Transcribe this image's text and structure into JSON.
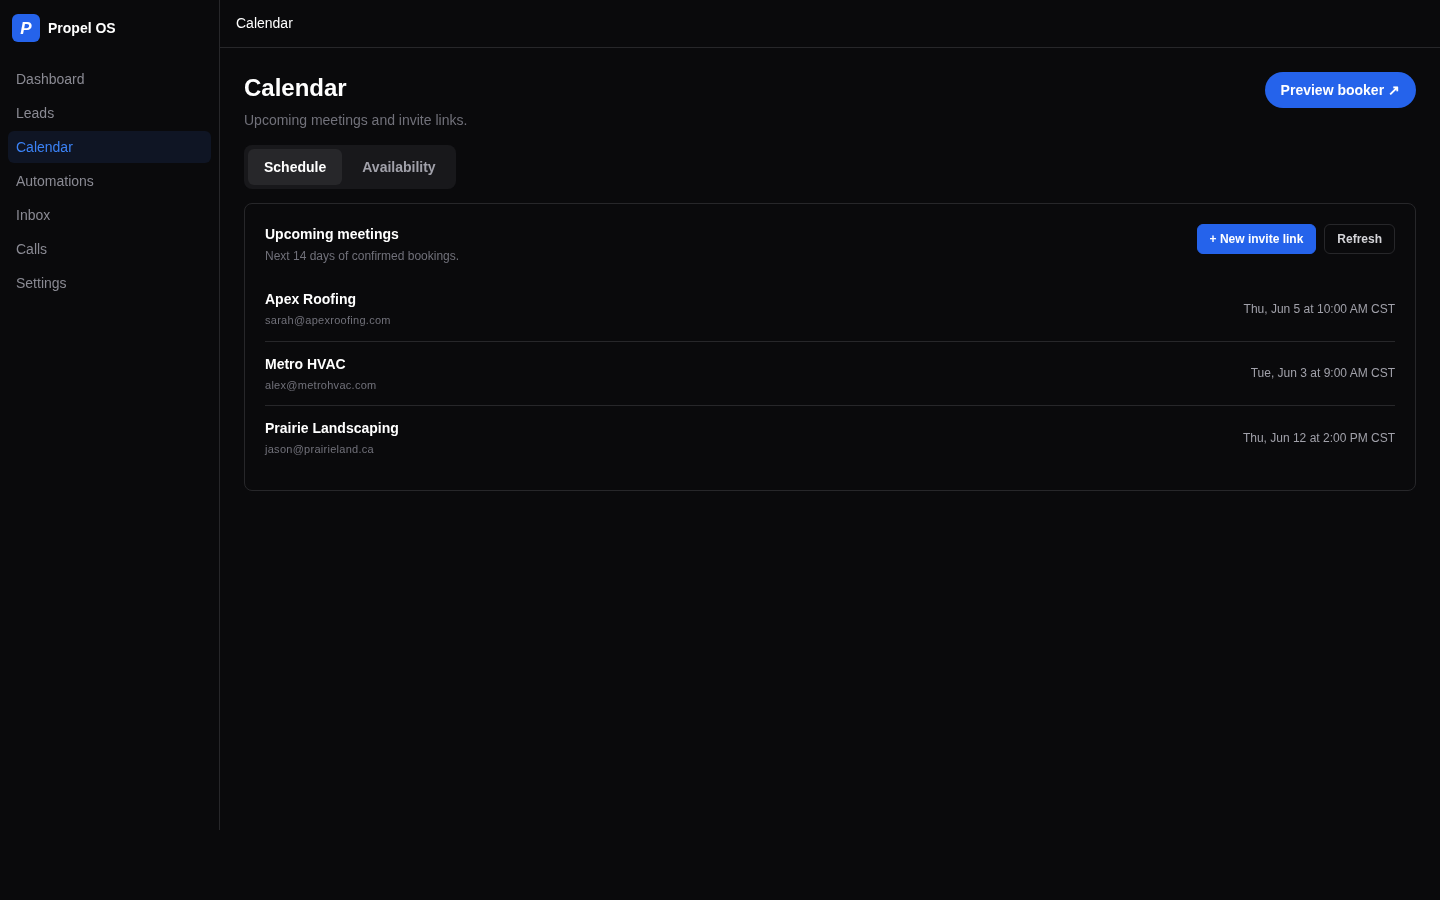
{
  "sidebar": {
    "brand": {
      "logo_letter": "P",
      "name": "Propel OS"
    },
    "items": [
      {
        "label": "Dashboard",
        "selected": false
      },
      {
        "label": "Leads",
        "selected": false
      },
      {
        "label": "Calendar",
        "selected": true
      },
      {
        "label": "Automations",
        "selected": false
      },
      {
        "label": "Inbox",
        "selected": false
      },
      {
        "label": "Calls",
        "selected": false
      },
      {
        "label": "Settings",
        "selected": false
      }
    ]
  },
  "header": {
    "title": "Calendar"
  },
  "page": {
    "title": "Calendar",
    "subtitle": "Upcoming meetings and invite links.",
    "action": "Preview booker ↗"
  },
  "tabs": [
    {
      "label": "Schedule",
      "selected": true
    },
    {
      "label": "Availability",
      "selected": false
    }
  ],
  "meetings_card": {
    "title": "Upcoming meetings",
    "subtitle": "Next 14 days of confirmed bookings.",
    "buttons": [
      {
        "label": "+ New invite link",
        "kind": "primary"
      },
      {
        "label": "Refresh",
        "kind": "outline"
      }
    ],
    "rows": [
      {
        "name": "Apex Roofing",
        "email": "sarah@apexroofing.com",
        "time": "Thu, Jun 5 at 10:00 AM CST"
      },
      {
        "name": "Metro HVAC",
        "email": "alex@metrohvac.com",
        "time": "Tue, Jun 3 at 9:00 AM CST"
      },
      {
        "name": "Prairie Landscaping",
        "email": "jason@prairieland.ca",
        "time": "Thu, Jun 12 at 2:00 PM CST"
      }
    ]
  }
}
